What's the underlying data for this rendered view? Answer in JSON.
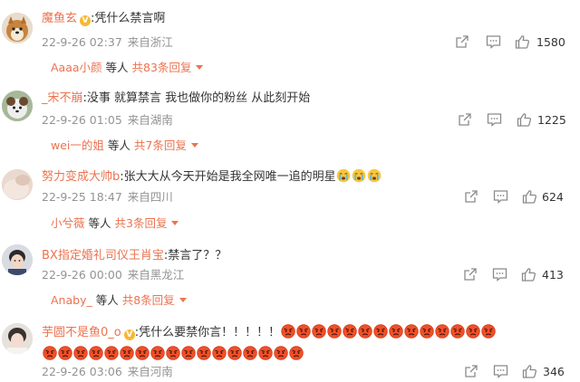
{
  "comments": [
    {
      "username": "魔鱼玄",
      "has_badge": true,
      "text": ":凭什么禁言啊",
      "date": "22-9-26 02:37",
      "location": "来自浙江",
      "likes": "1580",
      "replies": {
        "name": "Aaaa小颜",
        "mid": "等人",
        "count": "共83条回复"
      }
    },
    {
      "username": "_宋不崩",
      "text": ":没事  就算禁言  我也做你的粉丝 从此刻开始",
      "date": "22-9-26 01:05",
      "location": "来自湖南",
      "likes": "1225",
      "replies": {
        "name": "wei一的姐",
        "mid": "等人",
        "count": "共7条回复"
      }
    },
    {
      "username": "努力变成大帅b",
      "text": ":张大大从今天开始是我全网唯一追的明星",
      "emoji_after": "crying-emoji",
      "emoji_count": 3,
      "date": "22-9-25 18:47",
      "location": "来自四川",
      "likes": "624",
      "replies": {
        "name": "小兮薇",
        "mid": "等人",
        "count": "共3条回复"
      }
    },
    {
      "username": "BX指定婚礼司仪王肖宝",
      "text": ":禁言了？？",
      "date": "22-9-26 00:00",
      "location": "来自黑龙江",
      "likes": "413",
      "replies": {
        "name": "Anaby_",
        "mid": "等人",
        "count": "共8条回复"
      }
    },
    {
      "username": "芋圆不是鱼0_o",
      "has_badge": true,
      "text": ":凭什么要禁你言！！！！！",
      "emoji_after": "angry-face-emoji",
      "emoji_count_line1": 14,
      "emoji_count_line2": 17,
      "date": "22-9-26 03:06",
      "location": "来自河南",
      "likes": "346"
    }
  ],
  "icons": {
    "share": "share-icon",
    "comment": "comment-icon",
    "like": "thumbs-up-icon"
  },
  "colors": {
    "username": "#eb7350",
    "meta": "#939393",
    "icon": "#8a8a8a",
    "text": "#333333"
  }
}
